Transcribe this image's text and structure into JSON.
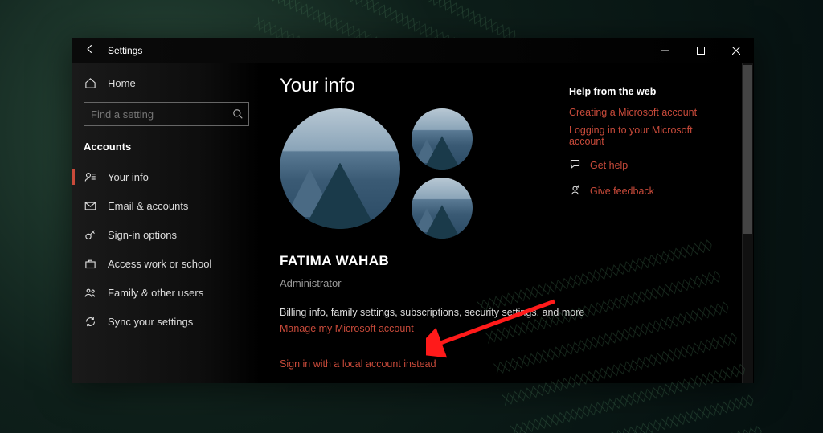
{
  "window": {
    "title": "Settings"
  },
  "sidebar": {
    "home": "Home",
    "search_placeholder": "Find a setting",
    "category": "Accounts",
    "items": [
      {
        "label": "Your info"
      },
      {
        "label": "Email & accounts"
      },
      {
        "label": "Sign-in options"
      },
      {
        "label": "Access work or school"
      },
      {
        "label": "Family & other users"
      },
      {
        "label": "Sync your settings"
      }
    ]
  },
  "content": {
    "heading": "Your info",
    "user_name": "FATIMA WAHAB",
    "role": "Administrator",
    "billing_text": "Billing info, family settings, subscriptions, security settings, and more",
    "manage_link": "Manage my Microsoft account",
    "local_link": "Sign in with a local account instead"
  },
  "help": {
    "heading": "Help from the web",
    "links": [
      "Creating a Microsoft account",
      "Logging in to your Microsoft account"
    ],
    "get_help": "Get help",
    "feedback": "Give feedback"
  }
}
